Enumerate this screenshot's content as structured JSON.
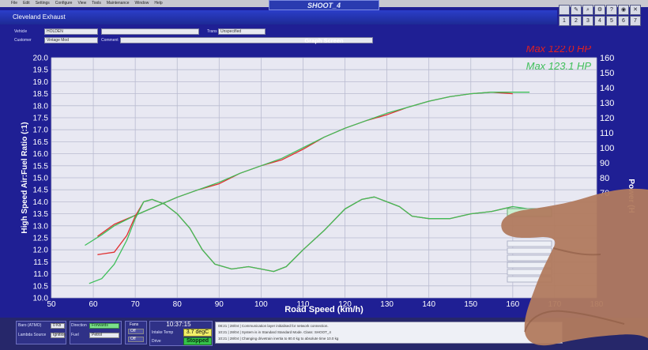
{
  "menu": [
    "File",
    "Edit",
    "Settings",
    "Configure",
    "View",
    "Tools",
    "Maintenance",
    "Window",
    "Help"
  ],
  "document_title": "SHOOT_4",
  "window_title": "Cleveland Exhaust",
  "toolbar_icons": [
    "graph-icon",
    "edit-icon",
    "zoom-icon",
    "gear-icon",
    "help-icon",
    "camera-icon",
    "close-icon",
    "grid-icon",
    "screen-1-icon",
    "screen-2-icon",
    "screen-3-icon",
    "screen-4-icon",
    "screen-5-icon",
    "screen-6-icon"
  ],
  "toolbar_labels": [
    "",
    "",
    "",
    "",
    "",
    "",
    "",
    "1",
    "2",
    "3",
    "4",
    "5",
    "6",
    "7"
  ],
  "info": {
    "vehicle_label": "Vehicle",
    "vehicle_value": "HOLDEN",
    "trans_label": "Trans",
    "trans_value": "Unspecified",
    "customer_label": "Customer",
    "customer_value": "Vintage Mod",
    "comment_label": "Comment"
  },
  "graph_title": "Graph Screen",
  "chart_data": {
    "type": "line",
    "xlabel": "Road Speed (km/h)",
    "ylabel": "High Speed Air:Fuel Ratio (:1)",
    "y2label": "Power (H",
    "xlim": [
      50,
      180
    ],
    "ylim": [
      10.0,
      20.0
    ],
    "y2lim": [
      0,
      160
    ],
    "x_ticks": [
      "50",
      "60",
      "70",
      "80",
      "90",
      "100",
      "110",
      "120",
      "130",
      "140",
      "150",
      "160",
      "170",
      "180"
    ],
    "y_ticks": [
      "10.0",
      "10.5",
      "11.0",
      "11.5",
      "12.0",
      "12.5",
      "13.0",
      "13.5",
      "14.0",
      "14.5",
      "15.0",
      "15.5",
      "16.0",
      "16.5",
      "17.0",
      "17.5",
      "18.0",
      "18.5",
      "19.0",
      "19.5",
      "20.0"
    ],
    "y2_ticks": [
      "160",
      "150",
      "140",
      "130",
      "120",
      "110",
      "100",
      "90",
      "80",
      "70"
    ],
    "annotations": [
      {
        "text": "Max 122.0 HP",
        "color": "#e02020"
      },
      {
        "text": "Max 123.1 HP",
        "color": "#3fbf5a"
      }
    ],
    "series": [
      {
        "axis": "power",
        "color": "#e03030",
        "x": [
          61,
          65,
          70,
          75,
          80,
          85,
          90,
          95,
          100,
          105,
          110,
          115,
          120,
          125,
          130,
          135,
          140,
          145,
          150,
          155,
          160
        ],
        "y": [
          41,
          49,
          55,
          61,
          67,
          72,
          76,
          83,
          88,
          92,
          99,
          107,
          113,
          118,
          122,
          127,
          131,
          134,
          136,
          137,
          136
        ]
      },
      {
        "axis": "power",
        "color": "#3fbf5a",
        "x": [
          58,
          62,
          65,
          70,
          75,
          80,
          85,
          90,
          95,
          100,
          105,
          110,
          115,
          120,
          125,
          130,
          135,
          140,
          145,
          150,
          155,
          160,
          164
        ],
        "y": [
          35,
          42,
          48,
          55,
          61,
          67,
          72,
          77,
          83,
          88,
          93,
          100,
          107,
          113,
          118,
          123,
          127,
          131,
          134,
          136,
          137,
          137,
          137
        ]
      },
      {
        "axis": "afr",
        "color": "#e03030",
        "x": [
          61,
          65,
          68,
          70,
          72,
          74,
          77,
          80,
          83,
          86,
          89,
          93,
          97,
          100,
          103,
          106,
          110,
          115,
          120,
          124,
          127,
          130,
          133,
          136,
          140,
          145,
          150,
          155,
          160
        ],
        "y": [
          11.8,
          11.9,
          12.6,
          13.4,
          14.0,
          14.1,
          13.9,
          13.5,
          12.9,
          12.0,
          11.4,
          11.2,
          11.3,
          11.2,
          11.1,
          11.3,
          12.0,
          12.8,
          13.7,
          14.1,
          14.2,
          14.0,
          13.8,
          13.4,
          13.3,
          13.3,
          13.5,
          13.6,
          13.8
        ]
      },
      {
        "axis": "afr",
        "color": "#3fbf5a",
        "x": [
          59,
          62,
          65,
          68,
          70,
          72,
          74,
          77,
          80,
          83,
          86,
          89,
          93,
          97,
          100,
          103,
          106,
          110,
          115,
          120,
          124,
          127,
          130,
          133,
          136,
          140,
          145,
          150,
          155,
          160,
          164
        ],
        "y": [
          10.6,
          10.8,
          11.4,
          12.4,
          13.3,
          14.0,
          14.1,
          13.9,
          13.5,
          12.9,
          12.0,
          11.4,
          11.2,
          11.3,
          11.2,
          11.1,
          11.3,
          12.0,
          12.8,
          13.7,
          14.1,
          14.2,
          14.0,
          13.8,
          13.4,
          13.3,
          13.3,
          13.5,
          13.6,
          13.8,
          13.7
        ]
      }
    ]
  },
  "status": {
    "baro_label": "Baro (ATMO)",
    "baro_value": "0 Kb",
    "source_label": "Lambda Source",
    "source_value": "Ignition",
    "direction_label": "Direction",
    "direction_value": "Forwards",
    "fuel_label": "Fuel",
    "fuel_value": "Petrol",
    "fans_label": "Fans",
    "fans_off1": "Off",
    "fans_off2": "Off",
    "clock": "10:37:15",
    "intake_label": "Intake Temp",
    "intake_value": "3.7 degC",
    "drive_label": "Drive",
    "drive_value": "Stopped",
    "log_lines": [
      "08:21 | 28/04 | Communication layer initialised for network connection.",
      "10:21 | 28/04 | System is in Standard Standard Mode. Class: SHOOT_4",
      "10:21 | 28/04 | Changing drivetrain inertia to 80.0 kg to absolute time 10.0 kg"
    ]
  }
}
